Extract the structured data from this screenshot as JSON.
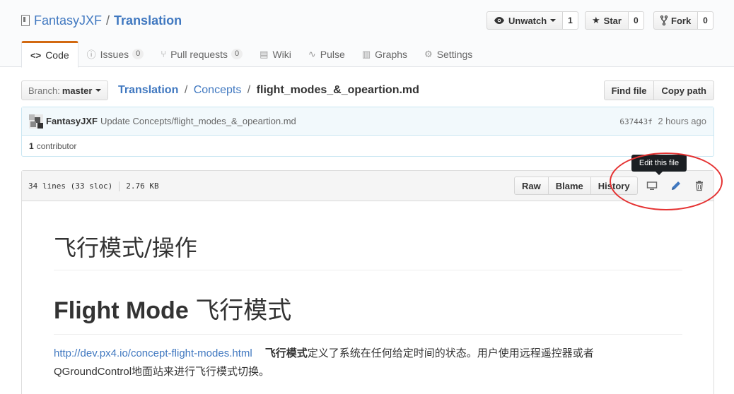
{
  "repo": {
    "owner": "FantasyJXF",
    "separator": "/",
    "name": "Translation"
  },
  "header_actions": {
    "unwatch": {
      "label": "Unwatch",
      "count": "1"
    },
    "star": {
      "label": "Star",
      "count": "0"
    },
    "fork": {
      "label": "Fork",
      "count": "0"
    }
  },
  "tabs": [
    {
      "label": "Code",
      "icon": "code-icon",
      "selected": true
    },
    {
      "label": "Issues",
      "icon": "issue-icon",
      "badge": "0"
    },
    {
      "label": "Pull requests",
      "icon": "pull-request-icon",
      "badge": "0"
    },
    {
      "label": "Wiki",
      "icon": "book-icon"
    },
    {
      "label": "Pulse",
      "icon": "pulse-icon"
    },
    {
      "label": "Graphs",
      "icon": "graph-icon"
    },
    {
      "label": "Settings",
      "icon": "gear-icon"
    }
  ],
  "branch": {
    "label": "Branch:",
    "value": "master"
  },
  "breadcrumb": {
    "root": "Translation",
    "sep": "/",
    "folder": "Concepts",
    "file": "flight_modes_&_opeartion.md"
  },
  "file_nav_buttons": {
    "find_file": "Find file",
    "copy_path": "Copy path"
  },
  "commit": {
    "author": "FantasyJXF",
    "message": "Update Concepts/flight_modes_&_opeartion.md",
    "sha": "637443f",
    "time": "2 hours ago"
  },
  "contributors": {
    "count": "1",
    "label": "contributor"
  },
  "file_header": {
    "lines": "34 lines (33 sloc)",
    "size": "2.76 KB",
    "raw": "Raw",
    "blame": "Blame",
    "history": "History",
    "tooltip": "Edit this file"
  },
  "content": {
    "h1": "飞行模式/操作",
    "h2_en": "Flight Mode",
    "h2_cn": "飞行模式",
    "link": "http://dev.px4.io/concept-flight-modes.html",
    "bold": "飞行模式",
    "text_line1": "定义了系统在任何给定时间的状态。用户使用远程遥控器或者",
    "text_line2": "QGroundControl地面站来进行飞行模式切换。"
  },
  "colors": {
    "link": "#4078c0",
    "tab_accent": "#d26911",
    "annotation": "#e53333"
  }
}
